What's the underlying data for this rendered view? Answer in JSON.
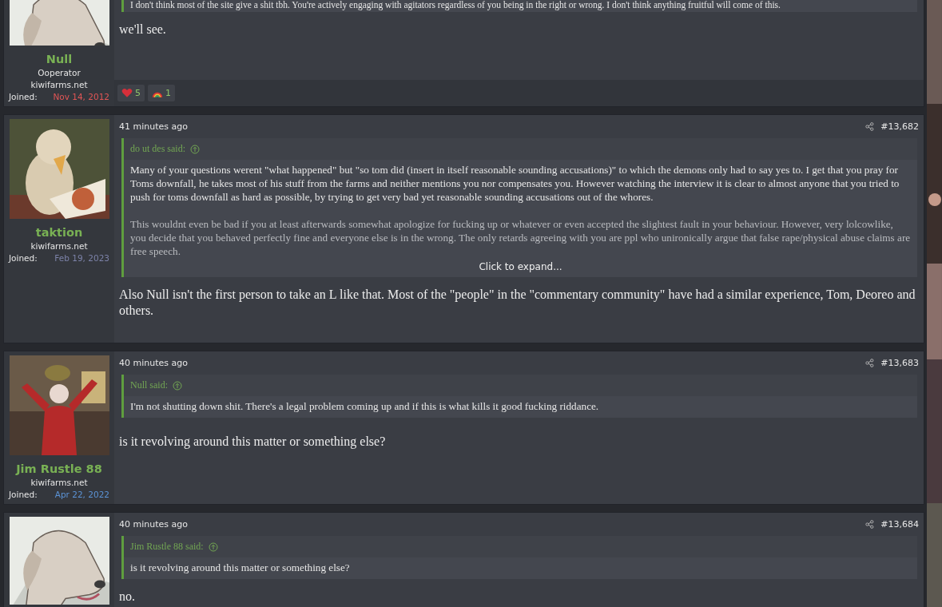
{
  "posts": [
    {
      "author": {
        "name": "Null",
        "title": "Ooperator",
        "site": "kiwifarms.net",
        "joined_label": "Joined:",
        "joined": "Nov 14, 2012",
        "color": "#e05555"
      },
      "quote": {
        "lines": [
          "I don't think most of the site give a shit tbh. You're actively engaging with agitators regardless of you being in the right or wrong. I don't think anything fruitful will come of this."
        ]
      },
      "body": [
        "we'll see."
      ],
      "reactions": [
        {
          "kind": "heart",
          "count": "5"
        },
        {
          "kind": "rainbow",
          "count": "1"
        }
      ]
    },
    {
      "author": {
        "name": "taktion",
        "site": "kiwifarms.net",
        "joined_label": "Joined:",
        "joined": "Feb 19, 2023",
        "color": "#7c82a8"
      },
      "time": "41 minutes ago",
      "number": "#13,682",
      "quote": {
        "said": "do ut des said:",
        "paragraphs": [
          "Many of your questions werent \"what happened\" but \"so tom did (insert in itself reasonable sounding accusations)\" to which the demons only had to say yes to. I get that you pray for Toms downfall, he takes most of his stuff from the farms and neither mentions you nor compensates you. However watching the interview it is clear to almost anyone that you tried to push for toms downfall as hard as possible, by trying to get very bad yet reasonable sounding accusations out of the whores.",
          "This wouldnt even be bad if you at least afterwards somewhat apologize for fucking up or whatever or even accepted the slightest fault in your behaviour. However, very lolcowlike, you decide that you behaved perfectly fine and everyone else is in the wrong. The only retards agreeing with you are ppl who unironically argue that false rape/physical abuse claims are free speech."
        ],
        "expand": "Click to expand..."
      },
      "body": [
        "Also Null isn't the first person to take an L like that. Most of the \"people\" in the \"commentary community\" have had a similar experience, Tom, Deoreo and others."
      ]
    },
    {
      "author": {
        "name": "Jim Rustle 88",
        "site": "kiwifarms.net",
        "joined_label": "Joined:",
        "joined": "Apr 22, 2022",
        "color": "#5b93d6"
      },
      "time": "40 minutes ago",
      "number": "#13,683",
      "quote": {
        "said": "Null said:",
        "paragraphs": [
          "I'm not shutting down shit. There's a legal problem coming up and if this is what kills it good fucking riddance."
        ]
      },
      "body": [
        "is it revolving around this matter or something else?"
      ]
    },
    {
      "time": "40 minutes ago",
      "number": "#13,684",
      "quote": {
        "said": "Jim Rustle 88 said:",
        "paragraphs": [
          "is it revolving around this matter or something else?"
        ]
      },
      "body": [
        "no."
      ]
    }
  ]
}
